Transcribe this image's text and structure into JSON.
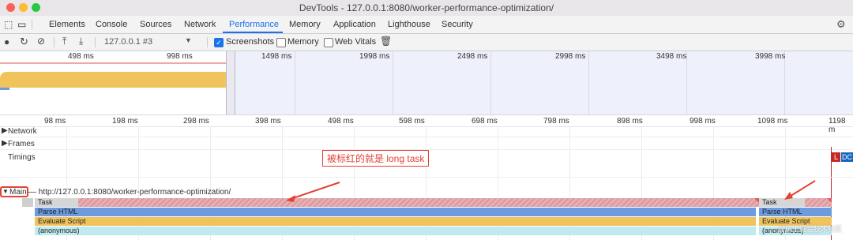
{
  "window": {
    "title": "DevTools - 127.0.0.1:8080/worker-performance-optimization/"
  },
  "tabs": [
    {
      "label": "Elements"
    },
    {
      "label": "Console"
    },
    {
      "label": "Sources"
    },
    {
      "label": "Network"
    },
    {
      "label": "Performance"
    },
    {
      "label": "Memory"
    },
    {
      "label": "Application"
    },
    {
      "label": "Lighthouse"
    },
    {
      "label": "Security"
    }
  ],
  "toolbar": {
    "profile_select": "127.0.0.1 #3",
    "screenshots_label": "Screenshots",
    "memory_label": "Memory",
    "webvitals_label": "Web Vitals",
    "screenshots_checked": true
  },
  "overview": {
    "ticks": [
      "498 ms",
      "998 ms",
      "1498 ms",
      "1998 ms",
      "2498 ms",
      "2998 ms",
      "3498 ms",
      "3998 ms"
    ]
  },
  "ruler": {
    "ticks": [
      "98 ms",
      "198 ms",
      "298 ms",
      "398 ms",
      "498 ms",
      "598 ms",
      "698 ms",
      "798 ms",
      "898 ms",
      "998 ms",
      "1098 ms",
      "1198 m"
    ]
  },
  "tracks": {
    "network": "Network",
    "frames": "Frames",
    "timings": "Timings",
    "main": "Main",
    "main_url": "— http://127.0.0.1:8080/worker-performance-optimization/",
    "timing_markers": [
      "L",
      "DC"
    ]
  },
  "annotation": {
    "text": "被标红的就是 long task"
  },
  "flame": {
    "task_left": "Task",
    "task_right": "Task",
    "parse_left": "Parse HTML",
    "parse_right": "Parse HTML",
    "eval_left": "Evaluate Script",
    "eval_right": "Evaluate Script",
    "anon_left": "(anonymous)",
    "anon_right": "(anonymous)"
  },
  "watermark": "@稀土掘金技术社区",
  "colors": {
    "accent": "#1a73e8",
    "long_task": "#e05a5a",
    "parse_html": "#6c9be0",
    "script": "#f0c35c"
  }
}
